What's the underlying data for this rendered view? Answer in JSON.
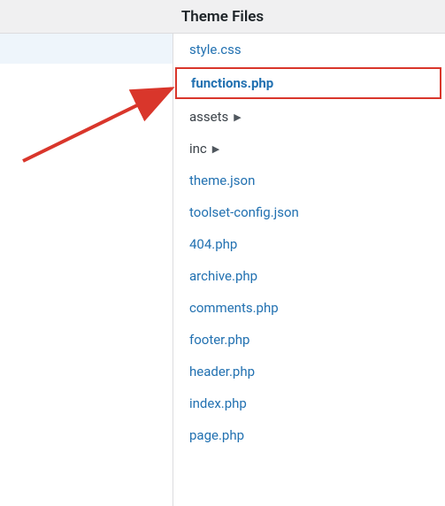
{
  "header": {
    "title": "Theme Files"
  },
  "files": [
    {
      "name": "style.css",
      "type": "file"
    },
    {
      "name": "functions.php",
      "type": "file",
      "highlighted": true
    },
    {
      "name": "assets",
      "type": "folder"
    },
    {
      "name": "inc",
      "type": "folder"
    },
    {
      "name": "theme.json",
      "type": "file"
    },
    {
      "name": "toolset-config.json",
      "type": "file"
    },
    {
      "name": "404.php",
      "type": "file"
    },
    {
      "name": "archive.php",
      "type": "file"
    },
    {
      "name": "comments.php",
      "type": "file"
    },
    {
      "name": "footer.php",
      "type": "file"
    },
    {
      "name": "header.php",
      "type": "file"
    },
    {
      "name": "index.php",
      "type": "file"
    },
    {
      "name": "page.php",
      "type": "file"
    }
  ],
  "annotation": {
    "arrow_color": "#d9362b",
    "highlight_color": "#d9362b"
  }
}
